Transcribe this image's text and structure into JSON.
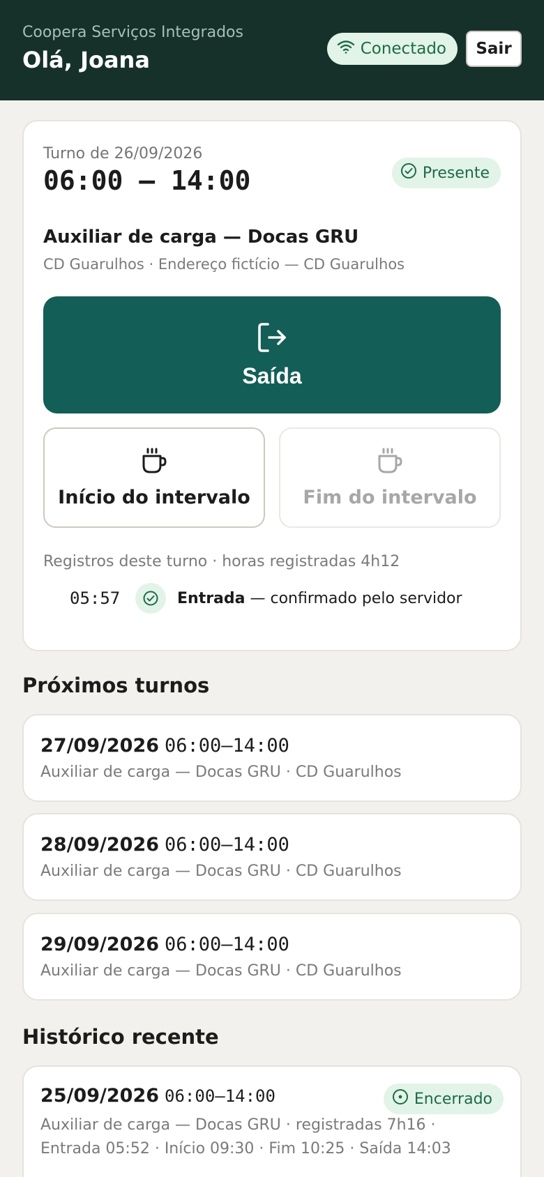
{
  "header": {
    "company": "Coopera Serviços Integrados",
    "greeting": "Olá, Joana",
    "connection_label": "Conectado",
    "logout_label": "Sair"
  },
  "shift": {
    "date_label": "Turno de 26/09/2026",
    "time_range": "06:00 – 14:00",
    "status": "Presente",
    "role": "Auxiliar de carga — Docas GRU",
    "location": "CD Guarulhos · Endereço fictício — CD Guarulhos",
    "exit_label": "Saída",
    "break_start_label": "Início do intervalo",
    "break_end_label": "Fim do intervalo",
    "records_title": "Registros deste turno · horas registradas 4h12",
    "records": [
      {
        "time": "05:57",
        "type": "Entrada",
        "detail": " — confirmado pelo servidor"
      }
    ]
  },
  "upcoming": {
    "title": "Próximos turnos",
    "items": [
      {
        "date": "27/09/2026",
        "time": "06:00–14:00",
        "sub": "Auxiliar de carga — Docas GRU · CD Guarulhos"
      },
      {
        "date": "28/09/2026",
        "time": "06:00–14:00",
        "sub": "Auxiliar de carga — Docas GRU · CD Guarulhos"
      },
      {
        "date": "29/09/2026",
        "time": "06:00–14:00",
        "sub": "Auxiliar de carga — Docas GRU · CD Guarulhos"
      }
    ]
  },
  "history": {
    "title": "Histórico recente",
    "items": [
      {
        "date": "25/09/2026",
        "time": "06:00–14:00",
        "status": "Encerrado",
        "sub": "Auxiliar de carga — Docas GRU · registradas 7h16 · Entrada 05:52 · Início 09:30 · Fim 10:25 · Saída 14:03"
      }
    ]
  },
  "colors": {
    "header_bg": "#15312a",
    "primary": "#135e56",
    "success_bg": "#e2f3e8",
    "success_text": "#1d6b45",
    "page_bg": "#f3f1ed"
  }
}
